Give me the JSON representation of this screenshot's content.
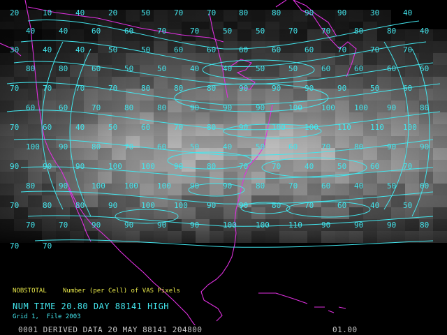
{
  "colors": {
    "background": "#000000",
    "contour": "#43e6ee",
    "coastline": "#e030e0",
    "field_label": "#e8e84a",
    "status_text": "#c8c8c8"
  },
  "info": {
    "field_name": "NOBSTOTAL",
    "field_desc": "Number (per Cell) of VAS Pixels",
    "time_line": "NUM TIME 20.80 DAY 88141 HIGH",
    "grid_line": "Grid 1,  File 2003"
  },
  "status": {
    "left": "0001 DERIVED DATA 20 MAY 88141 204800",
    "right": "01.00"
  },
  "contour_labels": [
    "20",
    "10",
    "40",
    "20",
    "50",
    "70",
    "70",
    "80",
    "80",
    "90",
    "90",
    "30",
    "40",
    "40",
    "40",
    "60",
    "60",
    "70",
    "70",
    "50",
    "50",
    "70",
    "70",
    "80",
    "80",
    "40",
    "30",
    "40",
    "40",
    "50",
    "50",
    "60",
    "60",
    "60",
    "60",
    "60",
    "70",
    "70",
    "70",
    "80",
    "80",
    "60",
    "50",
    "50",
    "40",
    "40",
    "50",
    "50",
    "60",
    "60",
    "60",
    "60",
    "70",
    "70",
    "70",
    "70",
    "80",
    "80",
    "80",
    "90",
    "90",
    "90",
    "90",
    "50",
    "60",
    "60",
    "60",
    "70",
    "80",
    "80",
    "90",
    "90",
    "90",
    "100",
    "100",
    "100",
    "90",
    "80",
    "70",
    "60",
    "40",
    "50",
    "60",
    "70",
    "80",
    "90",
    "100",
    "100",
    "110",
    "110",
    "100",
    "100",
    "90",
    "80",
    "70",
    "60",
    "50",
    "40",
    "50",
    "60",
    "70",
    "80",
    "90",
    "90",
    "90",
    "90",
    "90",
    "100",
    "100",
    "90",
    "80",
    "70",
    "70",
    "40",
    "50",
    "60",
    "70",
    "80",
    "90",
    "100",
    "100",
    "100",
    "90",
    "90",
    "80",
    "70",
    "60",
    "40",
    "50",
    "60",
    "70",
    "80",
    "80",
    "90",
    "100",
    "100",
    "90",
    "90",
    "80",
    "70",
    "60",
    "40",
    "50",
    "70",
    "70",
    "90",
    "90",
    "90",
    "90",
    "100",
    "100",
    "110",
    "90",
    "90",
    "90",
    "80",
    "70",
    "70"
  ]
}
